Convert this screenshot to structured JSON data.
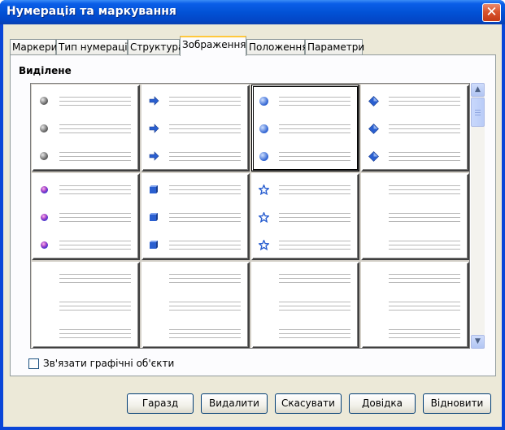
{
  "window": {
    "title": "Нумерація та маркування",
    "close_glyph": "✕"
  },
  "tabs": [
    {
      "label": "Маркери"
    },
    {
      "label": "Тип нумерації"
    },
    {
      "label": "Структура"
    },
    {
      "label": "Зображення",
      "active": true
    },
    {
      "label": "Положення"
    },
    {
      "label": "Параметри"
    }
  ],
  "section": {
    "label": "Виділене"
  },
  "gallery": {
    "selected_index": 2,
    "items": [
      {
        "icon": "gray-sphere-bullet-icon"
      },
      {
        "icon": "blue-arrow-bullet-icon"
      },
      {
        "icon": "blue-sphere-bullet-icon"
      },
      {
        "icon": "blue-diamond-bullet-icon"
      },
      {
        "icon": "purple-gem-bullet-icon"
      },
      {
        "icon": "blue-cube-bullet-icon"
      },
      {
        "icon": "blue-star-bullet-icon"
      },
      {
        "icon": "empty"
      },
      {
        "icon": "empty"
      },
      {
        "icon": "empty"
      },
      {
        "icon": "empty"
      },
      {
        "icon": "empty"
      }
    ]
  },
  "scrollbar": {
    "up_glyph": "▲",
    "down_glyph": "▼"
  },
  "link_graphics": {
    "label": "Зв'язати графічні об'єкти",
    "checked": false
  },
  "buttons": {
    "ok": "Гаразд",
    "delete": "Видалити",
    "cancel": "Скасувати",
    "help": "Довідка",
    "reset": "Відновити"
  },
  "colors": {
    "titlebar": "#0252d6",
    "dialog_bg": "#ece9d8",
    "active_tab_highlight": "#ffc83c",
    "bullet_blue": "#2a5fd0",
    "bullet_gray": "#555555",
    "bullet_purple": "#9a3cc8"
  }
}
